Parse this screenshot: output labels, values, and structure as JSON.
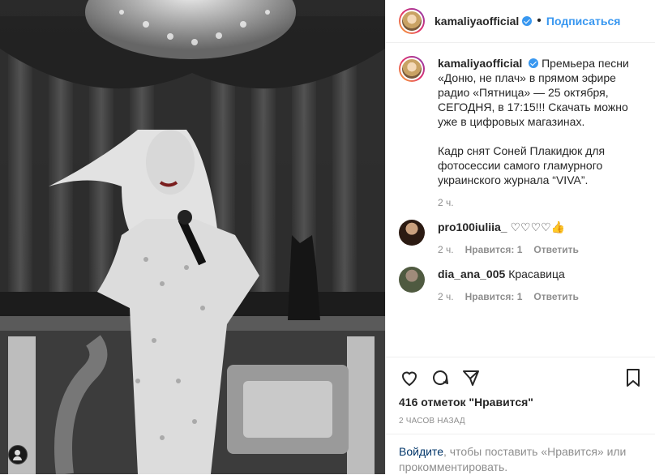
{
  "post": {
    "username": "kamaliyaofficial",
    "follow_label": "Подписаться",
    "caption": "Премьера песни «Доню, не плач» в прямом эфире радио «Пятница» — 25 октября, СЕГОДНЯ, в 17:15!!! Скачать можно уже в цифровых магазинах.\n\nКадр снят Соней Плакидюк для фотосессии самого гламурного украинского журнала “VIVA”.",
    "caption_time": "2 ч."
  },
  "comments": [
    {
      "username": "pro100iuliia_",
      "text": "♡♡♡♡👍",
      "time": "2 ч.",
      "likes": "Нравится: 1",
      "reply": "Ответить"
    },
    {
      "username": "dia_ana_005",
      "text": "Красавица",
      "time": "2 ч.",
      "likes": "Нравится: 1",
      "reply": "Ответить"
    }
  ],
  "actions": {
    "icons": [
      "heart-icon",
      "comment-icon",
      "share-icon",
      "bookmark-icon"
    ]
  },
  "likes_text": "416 отметок \"Нравится\"",
  "posted_time": "2 часов назад",
  "login": {
    "link": "Войдите",
    "rest": ", чтобы поставить «Нравится» или прокомментировать."
  },
  "colors": {
    "accent": "#3897f0",
    "text": "#262626",
    "muted": "#8e8e8e"
  }
}
